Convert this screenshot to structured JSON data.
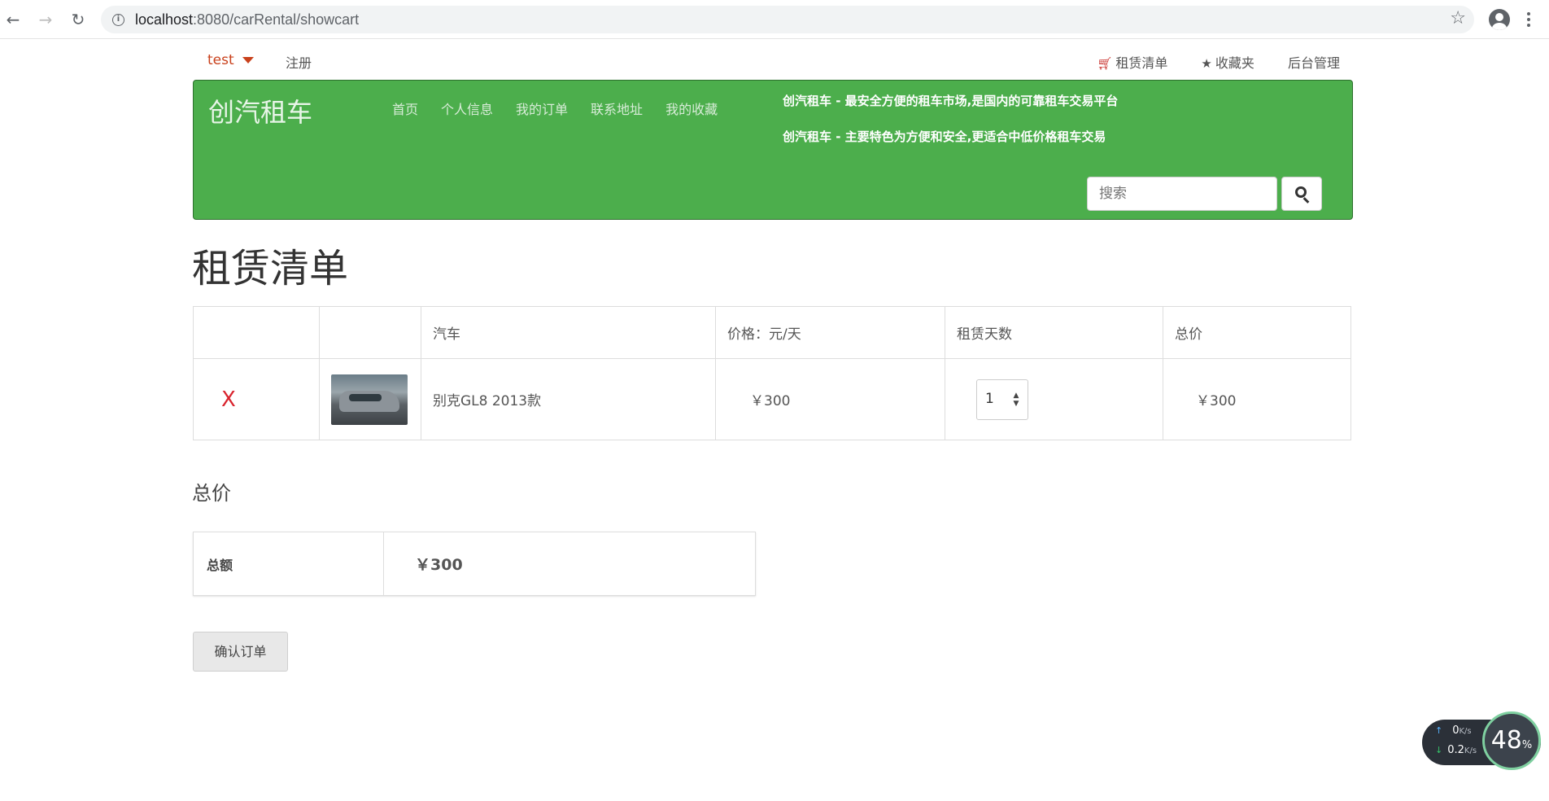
{
  "browser": {
    "url_host": "localhost",
    "url_rest": ":8080/carRental/showcart"
  },
  "topbar": {
    "user": "test",
    "register": "注册",
    "cart_link": "租赁清单",
    "favorites_link": "收藏夹",
    "admin_link": "后台管理"
  },
  "header": {
    "brand": "创汽租车",
    "nav": [
      "首页",
      "个人信息",
      "我的订单",
      "联系地址",
      "我的收藏"
    ],
    "slogan1": "创汽租车 - 最安全方便的租车市场,是国内的可靠租车交易平台",
    "slogan2": "创汽租车 - 主要特色为方便和安全,更适合中低价格租车交易",
    "search_placeholder": "搜索"
  },
  "page": {
    "title": "租赁清单"
  },
  "cart": {
    "headers": [
      "",
      "",
      "汽车",
      "价格：元/天",
      "租赁天数",
      "总价"
    ],
    "rows": [
      {
        "remove": "X",
        "car": "别克GL8 2013款",
        "price": "￥300",
        "days": "1",
        "total": "￥300"
      }
    ]
  },
  "summary": {
    "title": "总价",
    "label": "总额",
    "value": "￥300"
  },
  "actions": {
    "confirm": "确认订单"
  },
  "speed_widget": {
    "up_value": "0",
    "up_unit": "K/s",
    "down_value": "0.2",
    "down_unit": "K/s",
    "percent_value": "48",
    "percent_unit": "%"
  },
  "colors": {
    "header_green": "#4cae4c",
    "user_red": "#c9411c",
    "remove_red": "#d9232d"
  }
}
